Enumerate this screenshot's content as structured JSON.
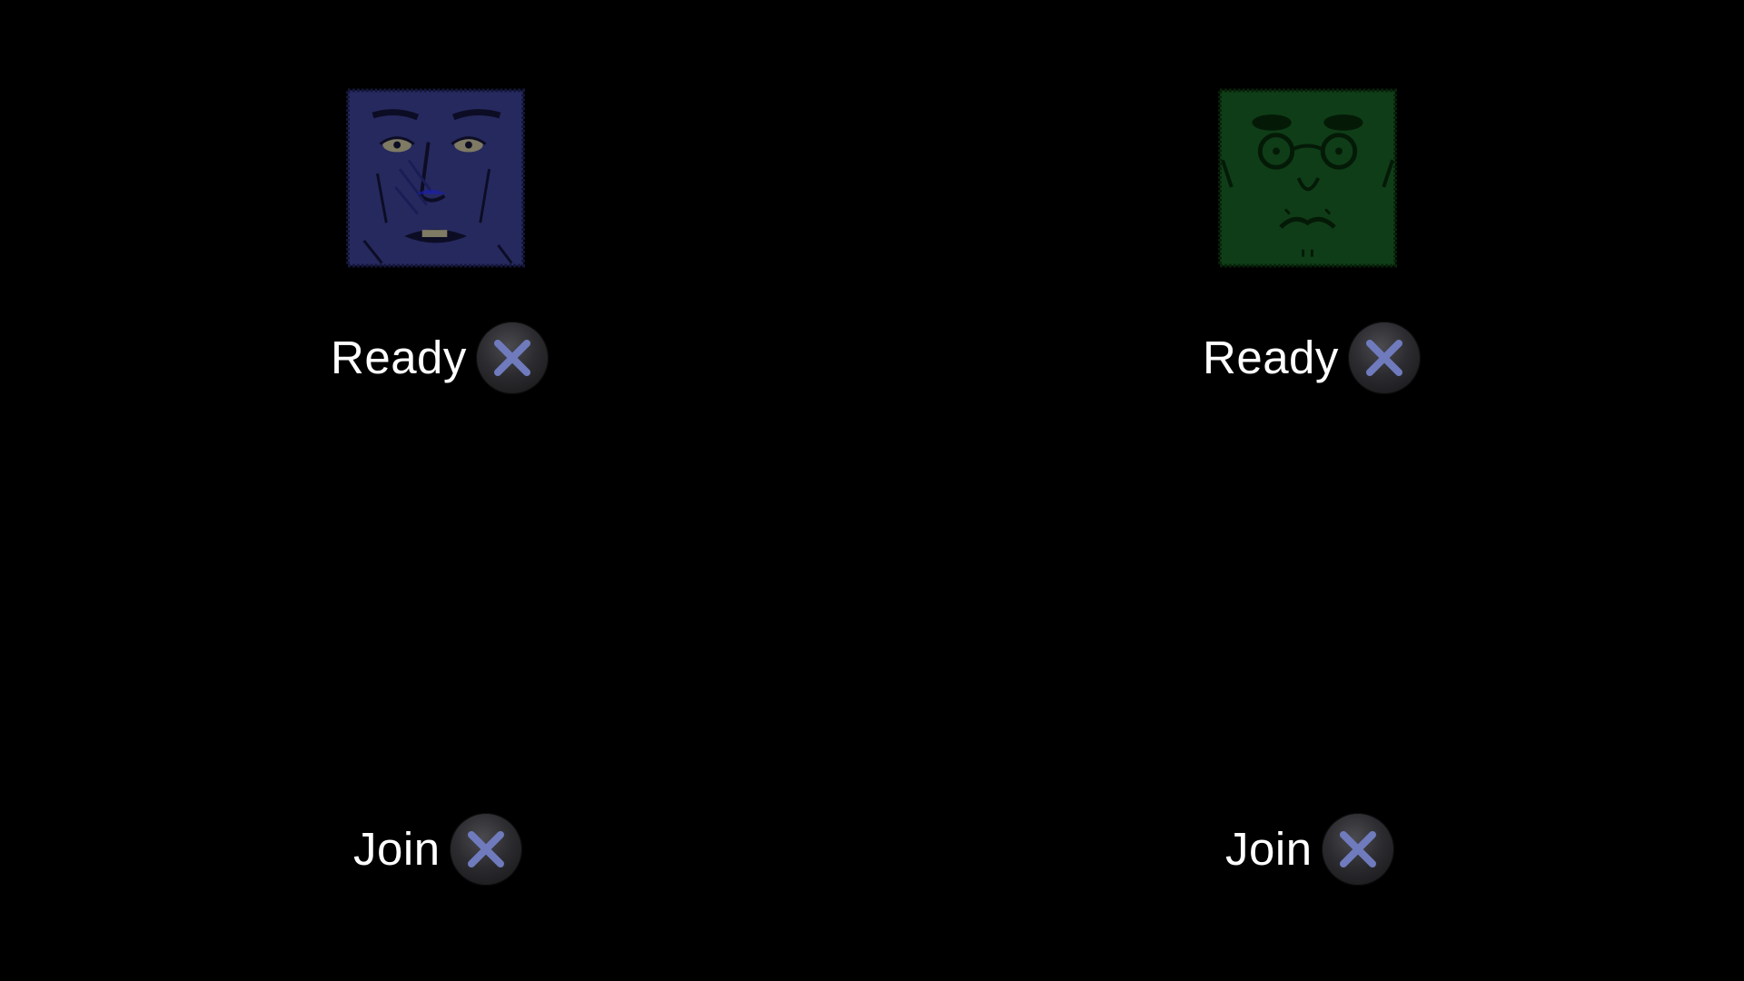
{
  "colors": {
    "background": "#000000",
    "p1_portrait": "#26295e",
    "p2_portrait": "#0f3d17",
    "button_x": "#6f7bbd",
    "text": "#ffffff"
  },
  "players": [
    {
      "slot": "top-left",
      "status_label": "Ready",
      "button_icon": "cross-button-icon",
      "portrait_icon": "blue-face-portrait"
    },
    {
      "slot": "top-right",
      "status_label": "Ready",
      "button_icon": "cross-button-icon",
      "portrait_icon": "green-face-portrait"
    },
    {
      "slot": "bottom-left",
      "status_label": "Join",
      "button_icon": "cross-button-icon"
    },
    {
      "slot": "bottom-right",
      "status_label": "Join",
      "button_icon": "cross-button-icon"
    }
  ]
}
